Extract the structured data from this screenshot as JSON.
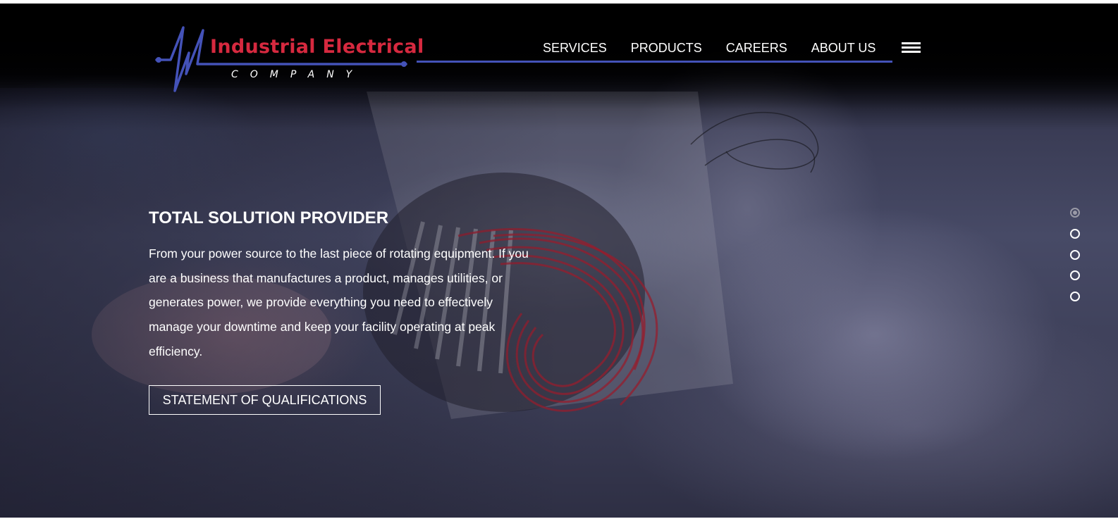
{
  "brand": {
    "name": "Industrial Electrical",
    "subtitle": "COMPANY",
    "primary_color": "#d6293f",
    "accent_color": "#4452b8"
  },
  "nav": {
    "items": [
      {
        "label": "SERVICES"
      },
      {
        "label": "PRODUCTS"
      },
      {
        "label": "CAREERS"
      },
      {
        "label": "ABOUT US"
      }
    ],
    "menu_icon": "hamburger-menu-icon"
  },
  "hero": {
    "title": "TOTAL SOLUTION PROVIDER",
    "body": "From your power source to the last piece of rotating equipment. If you are a business that manufactures a product, manages utilities, or generates power, we provide everything you need to effectively manage your downtime and keep your facility operating at peak efficiency.",
    "cta_label": "STATEMENT OF QUALIFICATIONS",
    "background_subject": "electric motor stator with copper windings"
  },
  "slider": {
    "slide_count": 5,
    "active_index": 0
  }
}
